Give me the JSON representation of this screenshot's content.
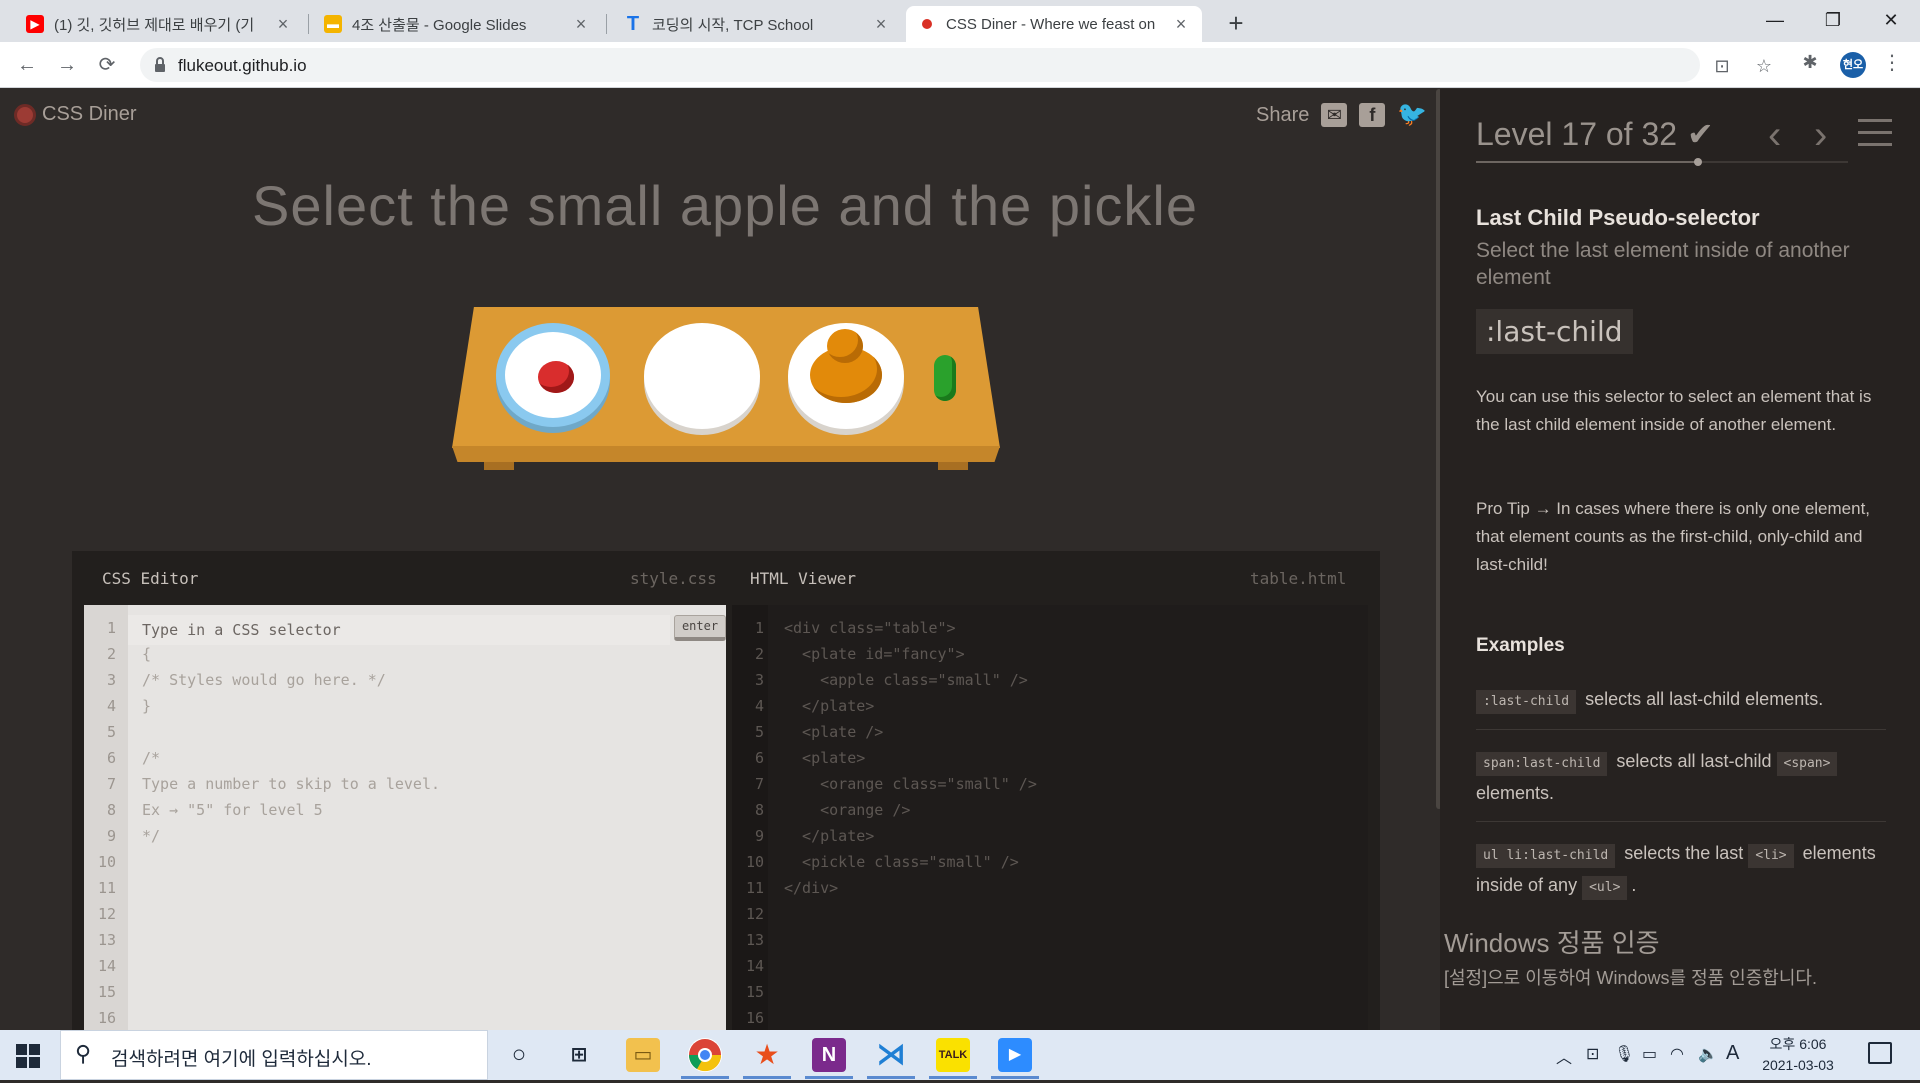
{
  "browser": {
    "tabs": [
      {
        "title": "(1) 깃, 깃허브 제대로 배우기 (기",
        "icon": "youtube-icon",
        "color": "#ff0000"
      },
      {
        "title": "4조 산출물 - Google Slides",
        "icon": "slides-icon",
        "color": "#f4b400"
      },
      {
        "title": "코딩의 시작, TCP School",
        "icon": "tcpschool-icon",
        "color": "#1a73e8"
      },
      {
        "title": "CSS Diner - Where we feast on",
        "icon": "cssdiner-icon",
        "color": "#c0392b"
      }
    ],
    "url": "flukeout.github.io",
    "profile_initials": "현오"
  },
  "page": {
    "logo": "CSS Diner",
    "share_label": "Share",
    "instruction": "Select the small apple and the pickle",
    "css_editor": {
      "label": "CSS Editor",
      "file": "style.css",
      "placeholder": "Type in a CSS selector",
      "enter_label": "enter",
      "lines": [
        "{",
        "/* Styles would go here. */",
        "}",
        "",
        "/*",
        "Type a number to skip to a level.",
        "Ex → \"5\" for level 5",
        "*/"
      ],
      "line_numbers": [
        "1",
        "2",
        "3",
        "4",
        "5",
        "6",
        "7",
        "8",
        "9",
        "10",
        "11",
        "12",
        "13",
        "14",
        "15",
        "16"
      ]
    },
    "html_viewer": {
      "label": "HTML Viewer",
      "file": "table.html",
      "lines": [
        "<div class=\"table\">",
        "  <plate id=\"fancy\">",
        "    <apple class=\"small\" />",
        "  </plate>",
        "  <plate />",
        "  <plate>",
        "    <orange class=\"small\" />",
        "    <orange />",
        "  </plate>",
        "  <pickle class=\"small\" />",
        "</div>"
      ],
      "line_numbers": [
        "1",
        "2",
        "3",
        "4",
        "5",
        "6",
        "7",
        "8",
        "9",
        "10",
        "11",
        "12",
        "13",
        "14",
        "15",
        "16"
      ]
    }
  },
  "sidebar": {
    "level_text": "Level 17 of 32",
    "level_progress": 0.53,
    "title": "Last Child Pseudo-selector",
    "description": "Select the last element inside of another element",
    "syntax": ":last-child",
    "paragraph1": "You can use this selector to select an element that is the last child element inside of another element.",
    "paragraph2": "Pro Tip → In cases where there is only one element, that element counts as the first-child, only-child and last-child!",
    "examples_title": "Examples",
    "examples": [
      {
        "code": ":last-child",
        "text": "selects all last-child elements."
      },
      {
        "code": "span:last-child",
        "text": "selects all last-child",
        "code2": "<span>",
        "text2": "elements."
      },
      {
        "code": "ul li:last-child",
        "text": "selects the last",
        "code2": "<li>",
        "text2": "elements inside of any",
        "code3": "<ul>",
        "text3": "."
      }
    ]
  },
  "watermark": {
    "line1": "Windows 정품 인증",
    "line2": "[설정]으로 이동하여 Windows를 정품 인증합니다."
  },
  "taskbar": {
    "search_placeholder": "검색하려면 여기에 입력하십시오.",
    "time": "오후 6:06",
    "date": "2021-03-03",
    "ime": "A"
  }
}
